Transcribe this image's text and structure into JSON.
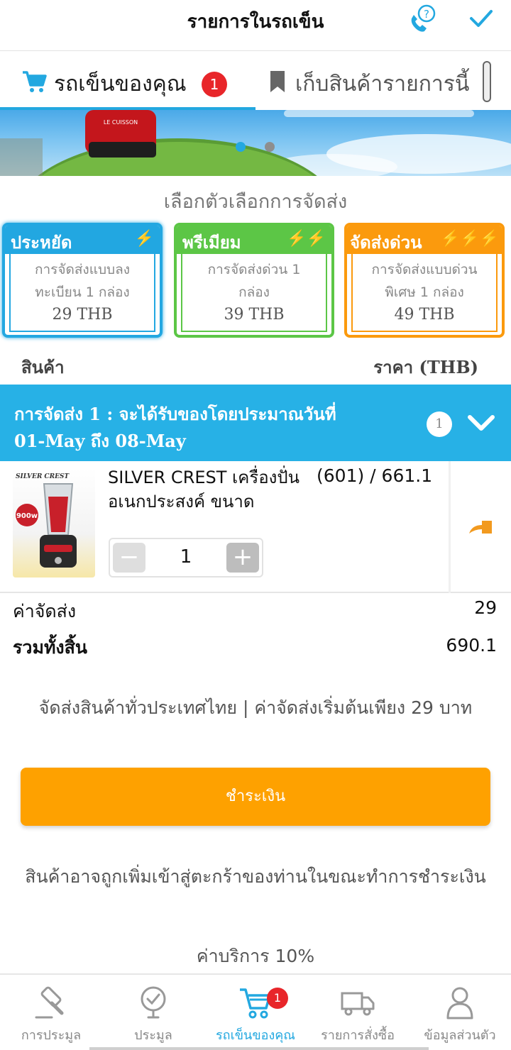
{
  "header": {
    "title": "รายการในรถเข็น",
    "help_icon": "phone-help-icon",
    "done_icon": "checkmark-icon"
  },
  "tabs": {
    "cart_label": "รถเข็นของคุณ",
    "cart_badge": "1",
    "save_label": "เก็บสินค้ารายการนี้"
  },
  "banner": {
    "brand_text": "LE CUISSON"
  },
  "shipping": {
    "title": "เลือกตัวเลือกการจัดส่ง",
    "options": [
      {
        "name": "ประหยัด",
        "bolts": "⚡",
        "line1": "การจัดส่งแบบลง",
        "line2": "ทะเบียน 1 กล่อง",
        "price": "29 THB",
        "color": "#22a7e1",
        "selected": true
      },
      {
        "name": "พรีเมียม",
        "bolts": "⚡⚡",
        "line1": "การจัดส่งด่วน 1",
        "line2": "กล่อง",
        "price": "39 THB",
        "color": "#5cc646",
        "selected": false
      },
      {
        "name": "จัดส่งด่วน",
        "bolts": "⚡⚡⚡",
        "line1": "การจัดส่งแบบด่วน",
        "line2": "พิเศษ 1 กล่อง",
        "price": "49 THB",
        "color": "#fb9a0d",
        "selected": false
      }
    ]
  },
  "columns": {
    "product": "สินค้า",
    "price": "ราคา (THB)"
  },
  "shipment": {
    "line1": "การจัดส่ง 1 : จะได้รับของโดยประมาณวันที่",
    "line2": "01-May ถึง 08-May",
    "count": "1"
  },
  "item": {
    "name": "SILVER CREST เครื่องปั่นอเนกประสงค์ ขนาด",
    "price": "(601) / 661.1",
    "quantity": "1",
    "thumb_brand": "SILVER CREST",
    "thumb_badge": "900w"
  },
  "totals": {
    "shipping_fee_label": "ค่าจัดส่ง",
    "shipping_fee_value": "29",
    "grand_total_label": "รวมทั้งสิ้น",
    "grand_total_value": "690.1"
  },
  "notice": "จัดส่งสินค้าทั่วประเทศไทย | ค่าจัดส่งเริ่มต้นเพียง 29 บาท",
  "pay_button": "ชำระเงิน",
  "warning": "สินค้าอาจถูกเพิ่มเข้าสู่ตะกร้าของท่านในขณะทำการชำระเงิน",
  "service_fee": "ค่าบริการ 10%",
  "bottom_nav": {
    "items": [
      {
        "label": "การประมูล",
        "icon": "gavel-icon"
      },
      {
        "label": "ประมูล",
        "icon": "bid-check-icon"
      },
      {
        "label": "รถเข็นของคุณ",
        "icon": "cart-icon",
        "badge": "1",
        "active": true
      },
      {
        "label": "รายการสั่งซื้อ",
        "icon": "truck-icon"
      },
      {
        "label": "ข้อมูลส่วนตัว",
        "icon": "user-icon"
      }
    ]
  },
  "colors": {
    "accent": "#23a8e0",
    "badge": "#e8262a",
    "pay": "#fea100"
  }
}
